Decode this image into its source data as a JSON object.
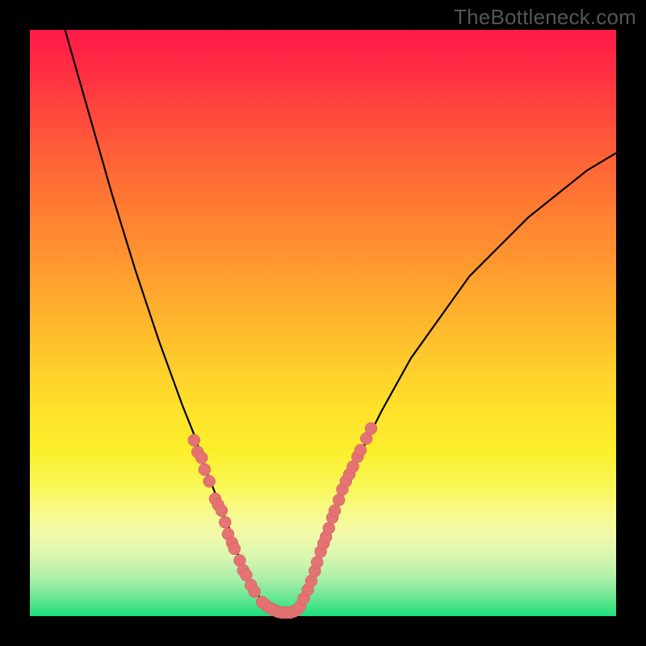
{
  "watermark": "TheBottleneck.com",
  "colors": {
    "frame": "#000000",
    "line": "#000000",
    "marker_fill": "#e57373",
    "marker_stroke": "#c46060"
  },
  "chart_data": {
    "type": "line",
    "title": "",
    "xlabel": "",
    "ylabel": "",
    "xlim": [
      0,
      100
    ],
    "ylim": [
      0,
      100
    ],
    "series": [
      {
        "name": "bottleneck-curve-left",
        "x": [
          6,
          10,
          14,
          18,
          22,
          26,
          28,
          30,
          32,
          34,
          35,
          36,
          37,
          38,
          39,
          40,
          41,
          42
        ],
        "values": [
          100,
          86,
          72,
          59,
          47,
          36,
          31,
          25,
          20,
          15,
          12,
          9,
          7,
          5,
          3.5,
          2,
          1,
          0.5
        ]
      },
      {
        "name": "bottleneck-curve-right",
        "x": [
          42,
          44,
          46,
          48,
          50,
          52,
          55,
          60,
          65,
          70,
          75,
          80,
          85,
          90,
          95,
          100
        ],
        "values": [
          0.5,
          1,
          2.5,
          6,
          12,
          18,
          25,
          35,
          44,
          51,
          58,
          63,
          68,
          72,
          76,
          79
        ]
      }
    ],
    "markers": {
      "name": "highlight-points",
      "points": [
        {
          "x": 28.0,
          "y": 30
        },
        {
          "x": 28.6,
          "y": 28
        },
        {
          "x": 29.3,
          "y": 27
        },
        {
          "x": 29.8,
          "y": 25
        },
        {
          "x": 30.6,
          "y": 23
        },
        {
          "x": 31.6,
          "y": 20
        },
        {
          "x": 32.1,
          "y": 19
        },
        {
          "x": 32.7,
          "y": 18
        },
        {
          "x": 33.3,
          "y": 16
        },
        {
          "x": 33.8,
          "y": 14
        },
        {
          "x": 34.5,
          "y": 12.5
        },
        {
          "x": 34.9,
          "y": 11.5
        },
        {
          "x": 35.8,
          "y": 9.5
        },
        {
          "x": 36.4,
          "y": 7.8
        },
        {
          "x": 36.9,
          "y": 7
        },
        {
          "x": 37.7,
          "y": 5.3
        },
        {
          "x": 38.3,
          "y": 4.2
        },
        {
          "x": 39.6,
          "y": 2.4
        },
        {
          "x": 40.2,
          "y": 1.9
        },
        {
          "x": 40.9,
          "y": 1.4
        },
        {
          "x": 41.4,
          "y": 1.1
        },
        {
          "x": 42.0,
          "y": 0.9
        },
        {
          "x": 42.5,
          "y": 0.7
        },
        {
          "x": 43.1,
          "y": 0.6
        },
        {
          "x": 43.7,
          "y": 0.6
        },
        {
          "x": 44.4,
          "y": 0.6
        },
        {
          "x": 45.0,
          "y": 0.8
        },
        {
          "x": 45.6,
          "y": 1.1
        },
        {
          "x": 46.1,
          "y": 1.7
        },
        {
          "x": 46.7,
          "y": 3
        },
        {
          "x": 47.4,
          "y": 4.5
        },
        {
          "x": 48.0,
          "y": 6
        },
        {
          "x": 48.6,
          "y": 7.7
        },
        {
          "x": 49.0,
          "y": 9.2
        },
        {
          "x": 49.6,
          "y": 11
        },
        {
          "x": 50.1,
          "y": 12.4
        },
        {
          "x": 50.5,
          "y": 13.5
        },
        {
          "x": 51.0,
          "y": 15
        },
        {
          "x": 51.6,
          "y": 16.8
        },
        {
          "x": 52.0,
          "y": 18
        },
        {
          "x": 52.7,
          "y": 19.8
        },
        {
          "x": 53.3,
          "y": 21.6
        },
        {
          "x": 53.9,
          "y": 23
        },
        {
          "x": 54.5,
          "y": 24.2
        },
        {
          "x": 55.1,
          "y": 25.5
        },
        {
          "x": 55.9,
          "y": 27.2
        },
        {
          "x": 56.4,
          "y": 28.3
        },
        {
          "x": 57.4,
          "y": 30.3
        },
        {
          "x": 58.2,
          "y": 32
        }
      ]
    }
  }
}
